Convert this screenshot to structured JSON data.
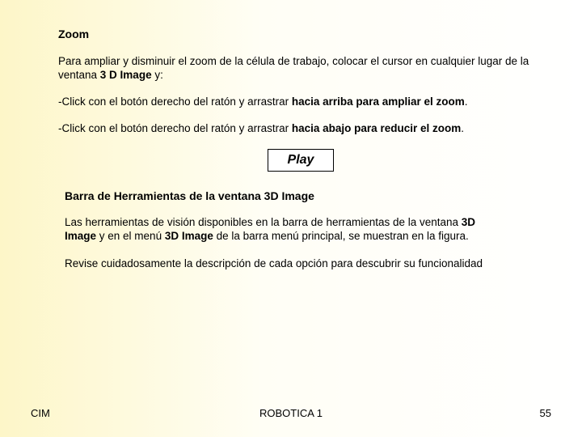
{
  "zoom": {
    "title": "Zoom",
    "intro_a": "Para ampliar y disminuir el zoom de la célula de trabajo, colocar el cursor en cualquier lugar de la ventana ",
    "intro_b": "3 D Image",
    "intro_c": " y:",
    "line1_a": "-Click con el botón derecho del ratón y arrastrar ",
    "line1_b": "hacia arriba para ampliar el zoom",
    "line1_c": ".",
    "line2_a": "-Click con el botón derecho del ratón y arrastrar ",
    "line2_b": "hacia abajo para reducir el zoom",
    "line2_c": "."
  },
  "play_label": "Play",
  "toolbar": {
    "title": "Barra de Herramientas de la ventana 3D Image",
    "p1_a": "Las herramientas de visión disponibles en la barra de herramientas de la ventana ",
    "p1_b": "3D Image",
    "p1_c": " y en el menú ",
    "p1_d": "3D Image",
    "p1_e": " de la barra menú principal, se muestran en la figura.",
    "p2": "Revise cuidadosamente la descripción de cada opción para descubrir su funcionalidad"
  },
  "footer": {
    "left": "CIM",
    "center": "ROBOTICA 1",
    "page": "55"
  }
}
